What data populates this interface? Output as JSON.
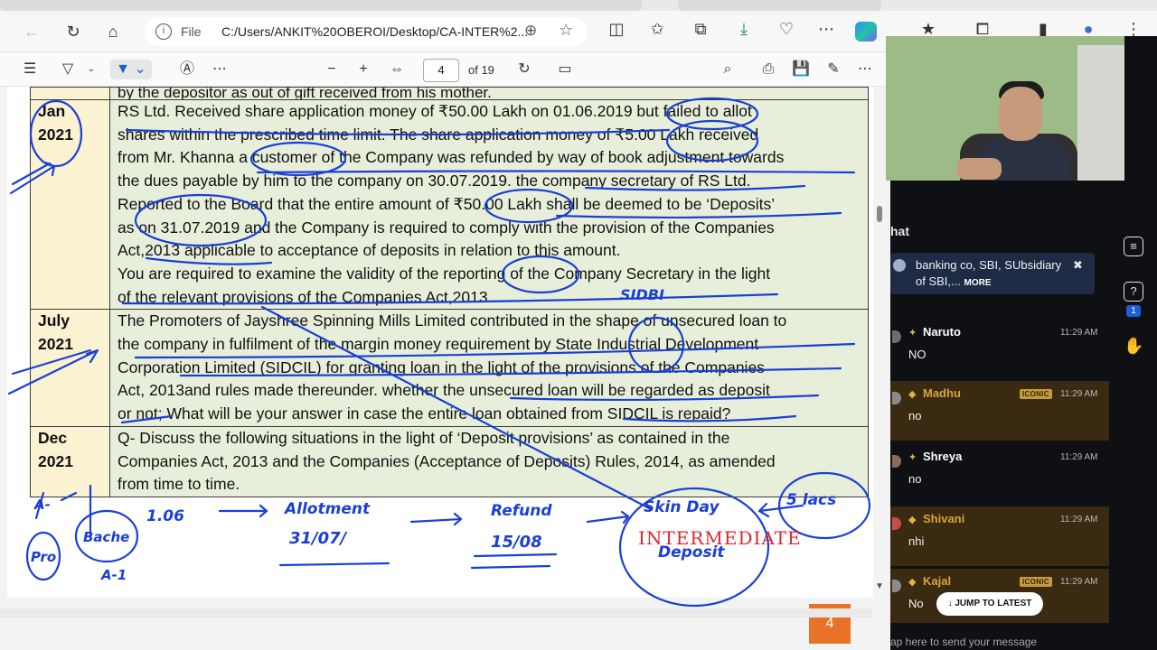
{
  "browser": {
    "file_label": "File",
    "url": "C:/Users/ANKIT%20OBEROI/Desktop/CA-INTER%2..."
  },
  "pdf_toolbar": {
    "current_page": "4",
    "page_of": "of 19"
  },
  "document": {
    "top_cut_text": "by the depositor as out of gift received from his mother.",
    "rows": [
      {
        "when": [
          "Jan",
          "2021"
        ],
        "lines": [
          "RS Ltd. Received share application money of ₹50.00 Lakh on 01.06.2019 but failed to allot",
          "shares within the prescribed time limit. The share application money of ₹5.00 Lakh received",
          "from Mr. Khanna a customer of the Company was refunded by way of book adjustment towards",
          "the dues payable by him to the company on 30.07.2019. the company secretary of RS Ltd.",
          "Reported to the Board that the entire amount of ₹50.00 Lakh shall be deemed to be ‘Deposits’",
          "as on 31.07.2019 and the Company is required to comply with the provision of the Companies",
          "Act,2013 applicable to acceptance of deposits in relation to this amount.",
          "You are required to examine the validity of the reporting of the Company Secretary in the light",
          "of the relevant provisions of the Companies Act,2013."
        ]
      },
      {
        "when": [
          "July",
          "2021"
        ],
        "lines": [
          "The Promoters of Jayshree Spinning Mills Limited contributed in the shape of unsecured loan to",
          "the company in fulfilment of the margin money requirement by State Industrial Development",
          "Corporation Limited (SIDCIL) for granting loan in the light of the provisions of the Companies",
          "Act, 2013and rules made thereunder. whether the unsecured loan will be regarded as deposit",
          "or not; What will be your answer in case the entire loan obtained from SIDCIL is repaid?"
        ]
      },
      {
        "when": [
          "Dec",
          "2021"
        ],
        "lines": [
          "Q- Discuss the following situations in the light of ‘Deposit provisions’ as contained in the",
          "Companies Act, 2013 and the Companies (Acceptance of Deposits) Rules, 2014, as amended",
          "from time to time."
        ]
      }
    ],
    "annotations": {
      "sidbi": "SIDBI",
      "date_106": "1.06",
      "allotment": "Allotment",
      "allot_date": "31/07/",
      "refund": "Refund",
      "refund_date": "15/08",
      "skin_day": "Skin Day",
      "deposit": "Deposit",
      "five_lacs": "5 lacs",
      "pro": "Pro",
      "bache": "Bache",
      "a1": "A-",
      "a2": "A-1"
    },
    "stamp": "INTERMEDIATE",
    "page_badge": "4"
  },
  "chat": {
    "title": "hat",
    "pinned": {
      "text": "banking co, SBI, SUbsidiary of SBI,...",
      "more": "MORE"
    },
    "messages": [
      {
        "name": "Naruto",
        "time": "11:29 AM",
        "text": "NO",
        "iconic": false,
        "avatar_color": "#6d6d6d"
      },
      {
        "name": "Madhu",
        "time": "11:29 AM",
        "text": "no",
        "iconic": true,
        "badge": "ICONIC",
        "avatar_color": "#8a8a8a"
      },
      {
        "name": "Shreya",
        "time": "11:29 AM",
        "text": "no",
        "iconic": false,
        "avatar_color": "#8d6b5a"
      },
      {
        "name": "Shivani",
        "time": "11:29 AM",
        "text": "nhi",
        "iconic": true,
        "avatar_color": "#c0504d"
      },
      {
        "name": "Kajal",
        "time": "11:29 AM",
        "text": "No",
        "iconic": true,
        "badge": "ICONIC",
        "avatar_color": "#8a8a8a"
      }
    ],
    "jump_label": "↓ JUMP TO LATEST",
    "input_placeholder": "ap here to send your message"
  },
  "colors": {
    "ink": "#1a3fd6",
    "stamp": "#e0262b",
    "badge": "#e8722a",
    "date_col": "#fbf2d2",
    "text_col": "#e7efdb",
    "chat_bg": "#0f1014",
    "iconic_bg": "#3b2a12"
  },
  "icons": {
    "nav": [
      "back-icon",
      "refresh-icon",
      "home-icon"
    ],
    "toolbar": [
      "contents-icon",
      "draw-icon",
      "highlight-icon",
      "text-icon",
      "more-icon",
      "zoom-out-icon",
      "zoom-in-icon",
      "fit-icon",
      "rotate-icon",
      "two-page-icon",
      "search-icon",
      "print-icon",
      "save-icon",
      "save-as-icon"
    ]
  }
}
